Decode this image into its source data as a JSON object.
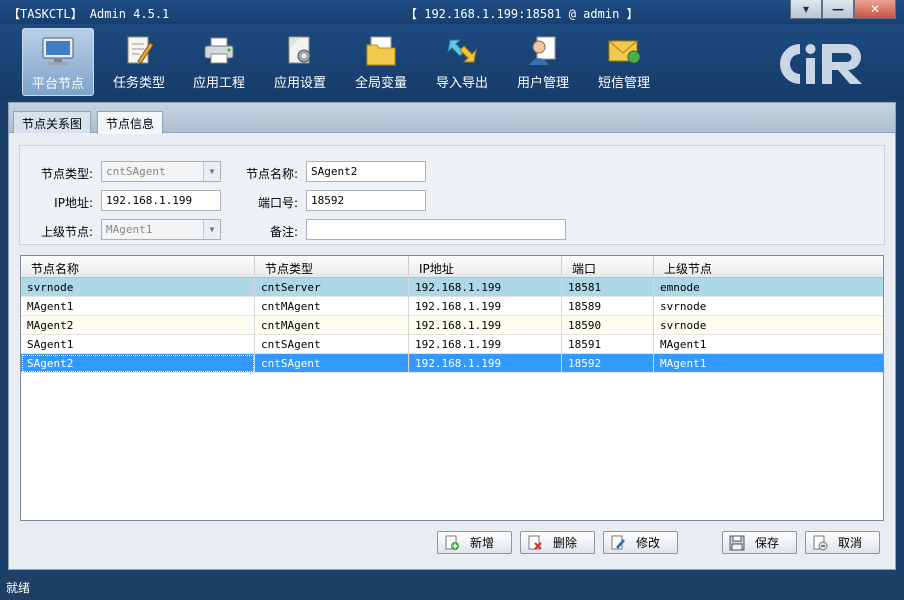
{
  "titlebar": {
    "app_title": "【TASKCTL】 Admin 4.5.1",
    "connection": "【 192.168.1.199:18581 @ admin 】",
    "minimize_glyph": "▾",
    "restore_glyph": "—",
    "close_glyph": "✕"
  },
  "toolbar": {
    "items": [
      {
        "label": "平台节点",
        "icon": "monitor-icon"
      },
      {
        "label": "任务类型",
        "icon": "document-edit-icon"
      },
      {
        "label": "应用工程",
        "icon": "printer-icon"
      },
      {
        "label": "应用设置",
        "icon": "settings-document-icon"
      },
      {
        "label": "全局变量",
        "icon": "folder-document-icon"
      },
      {
        "label": "导入导出",
        "icon": "import-export-icon"
      },
      {
        "label": "用户管理",
        "icon": "user-icon"
      },
      {
        "label": "短信管理",
        "icon": "envelope-icon"
      }
    ],
    "logo_text": "CIR"
  },
  "tabs": [
    {
      "label": "节点关系图"
    },
    {
      "label": "节点信息"
    }
  ],
  "form": {
    "node_type_label": "节点类型:",
    "node_type_value": "cntSAgent",
    "node_name_label": "节点名称:",
    "node_name_value": "SAgent2",
    "ip_label": "IP地址:",
    "ip_value": "192.168.1.199",
    "port_label": "端口号:",
    "port_value": "18592",
    "parent_label": "上级节点:",
    "parent_value": "MAgent1",
    "remark_label": "备注:",
    "remark_value": ""
  },
  "grid": {
    "columns": [
      "节点名称",
      "节点类型",
      "IP地址",
      "端口",
      "上级节点"
    ],
    "rows": [
      [
        "svrnode",
        "cntServer",
        "192.168.1.199",
        "18581",
        "emnode"
      ],
      [
        "MAgent1",
        "cntMAgent",
        "192.168.1.199",
        "18589",
        "svrnode"
      ],
      [
        "MAgent2",
        "cntMAgent",
        "192.168.1.199",
        "18590",
        "svrnode"
      ],
      [
        "SAgent1",
        "cntSAgent",
        "192.168.1.199",
        "18591",
        "MAgent1"
      ],
      [
        "SAgent2",
        "cntSAgent",
        "192.168.1.199",
        "18592",
        "MAgent1"
      ]
    ],
    "selected_row": 4
  },
  "buttons": {
    "add": "新增",
    "delete": "删除",
    "edit": "修改",
    "save": "保存",
    "cancel": "取消"
  },
  "status": {
    "text": "就绪"
  },
  "colors": {
    "title_bg": "#1f4c84",
    "selected_row": "#3399ff",
    "first_row": "#add8e6"
  }
}
